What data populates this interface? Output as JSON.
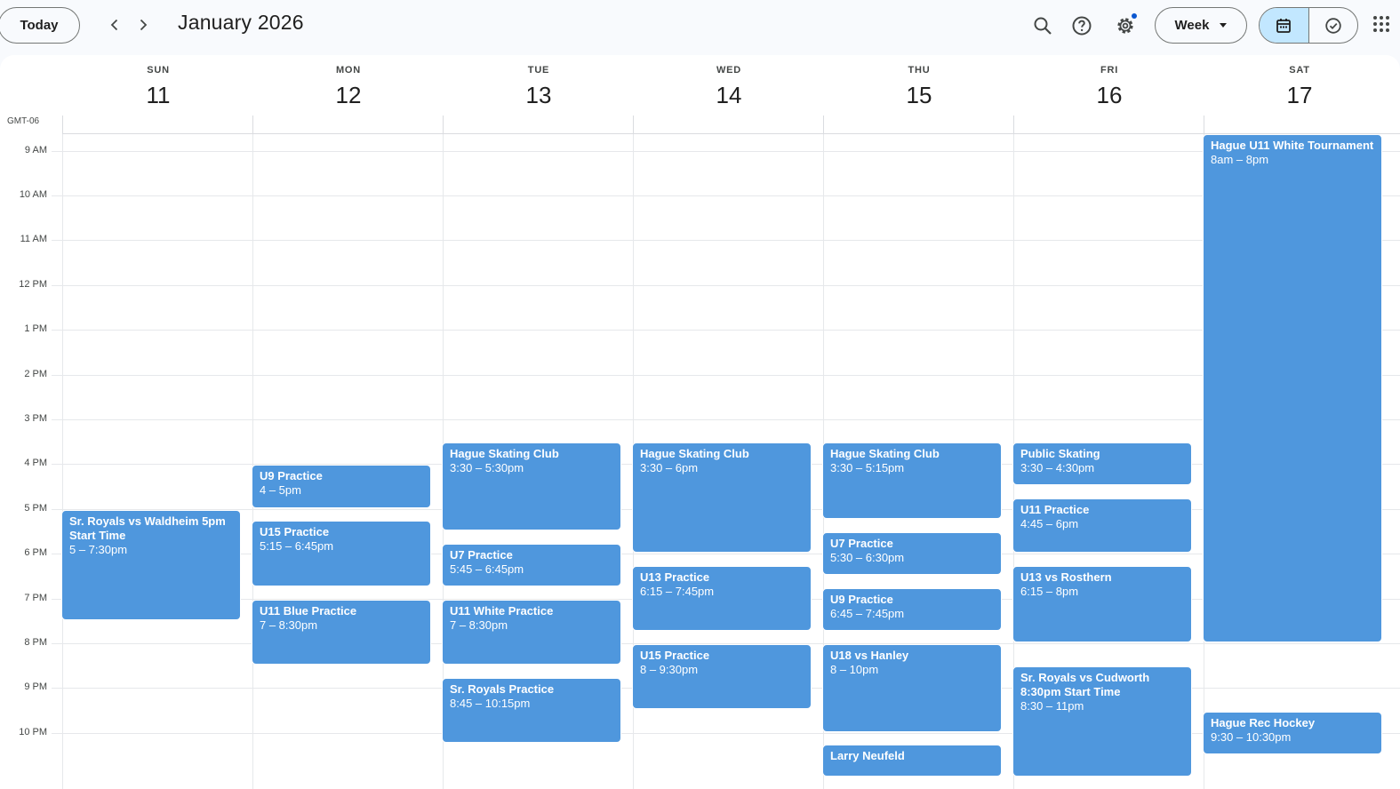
{
  "header": {
    "today_label": "Today",
    "month_title": "January 2026",
    "view_label": "Week",
    "icons": [
      "chevron-left-icon",
      "chevron-right-icon",
      "search-icon",
      "help-icon",
      "settings-icon",
      "calendar-icon",
      "tasks-check-icon",
      "apps-grid-icon"
    ]
  },
  "timezone": "GMT-06",
  "days": [
    {
      "dow": "SUN",
      "date": "11"
    },
    {
      "dow": "MON",
      "date": "12"
    },
    {
      "dow": "TUE",
      "date": "13"
    },
    {
      "dow": "WED",
      "date": "14"
    },
    {
      "dow": "THU",
      "date": "15"
    },
    {
      "dow": "FRI",
      "date": "16"
    },
    {
      "dow": "SAT",
      "date": "17"
    }
  ],
  "hours": [
    "9 AM",
    "10 AM",
    "11 AM",
    "12 PM",
    "1 PM",
    "2 PM",
    "3 PM",
    "4 PM",
    "5 PM",
    "6 PM",
    "7 PM",
    "8 PM",
    "9 PM",
    "10 PM"
  ],
  "colors": {
    "event": "#4f97dd",
    "selected_toggle": "#c2e7ff",
    "notification_dot": "#0b57d0"
  },
  "events": [
    {
      "day": 0,
      "title": "Sr. Royals vs Waldheim 5pm Start Time",
      "time": "5 – 7:30pm"
    },
    {
      "day": 1,
      "title": "U9 Practice",
      "time": "4 – 5pm"
    },
    {
      "day": 1,
      "title": "U15 Practice",
      "time": "5:15 – 6:45pm"
    },
    {
      "day": 1,
      "title": "U11 Blue Practice",
      "time": "7 – 8:30pm"
    },
    {
      "day": 2,
      "title": "Hague Skating Club",
      "time": "3:30 – 5:30pm"
    },
    {
      "day": 2,
      "title": "U7 Practice",
      "time": "5:45 – 6:45pm"
    },
    {
      "day": 2,
      "title": "U11 White Practice",
      "time": "7 – 8:30pm"
    },
    {
      "day": 2,
      "title": "Sr. Royals Practice",
      "time": "8:45 – 10:15pm"
    },
    {
      "day": 3,
      "title": "Hague Skating Club",
      "time": "3:30 – 6pm"
    },
    {
      "day": 3,
      "title": "U13 Practice",
      "time": "6:15 – 7:45pm"
    },
    {
      "day": 3,
      "title": "U15 Practice",
      "time": "8 – 9:30pm"
    },
    {
      "day": 4,
      "title": "Hague Skating Club",
      "time": "3:30 – 5:15pm"
    },
    {
      "day": 4,
      "title": "U7 Practice",
      "time": "5:30 – 6:30pm"
    },
    {
      "day": 4,
      "title": "U9 Practice",
      "time": "6:45 – 7:45pm"
    },
    {
      "day": 4,
      "title": "U18 vs Hanley",
      "time": "8 – 10pm"
    },
    {
      "day": 4,
      "title": "Larry Neufeld",
      "time": ""
    },
    {
      "day": 5,
      "title": "Public Skating",
      "time": "3:30 – 4:30pm"
    },
    {
      "day": 5,
      "title": "U11 Practice",
      "time": "4:45 – 6pm"
    },
    {
      "day": 5,
      "title": "U13 vs Rosthern",
      "time": "6:15 – 8pm"
    },
    {
      "day": 5,
      "title": "Sr. Royals vs Cudworth 8:30pm Start Time",
      "time": "8:30 – 11pm"
    },
    {
      "day": 6,
      "title": "Hague U11 White Tournament",
      "time": "8am – 8pm"
    },
    {
      "day": 6,
      "title": "Hague Rec Hockey",
      "time": "9:30 – 10:30pm"
    }
  ]
}
